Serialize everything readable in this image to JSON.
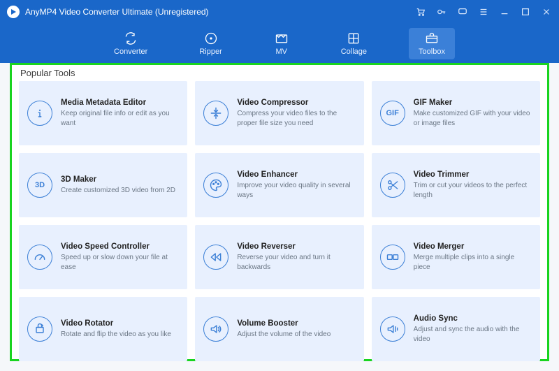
{
  "titlebar": {
    "app_title": "AnyMP4 Video Converter Ultimate (Unregistered)"
  },
  "nav": {
    "items": [
      {
        "label": "Converter"
      },
      {
        "label": "Ripper"
      },
      {
        "label": "MV"
      },
      {
        "label": "Collage"
      },
      {
        "label": "Toolbox"
      }
    ],
    "active_index": 4
  },
  "section": {
    "title": "Popular Tools"
  },
  "tools": [
    {
      "title": "Media Metadata Editor",
      "desc": "Keep original file info or edit as you want"
    },
    {
      "title": "Video Compressor",
      "desc": "Compress your video files to the proper file size you need"
    },
    {
      "title": "GIF Maker",
      "desc": "Make customized GIF with your video or image files"
    },
    {
      "title": "3D Maker",
      "desc": "Create customized 3D video from 2D"
    },
    {
      "title": "Video Enhancer",
      "desc": "Improve your video quality in several ways"
    },
    {
      "title": "Video Trimmer",
      "desc": "Trim or cut your videos to the perfect length"
    },
    {
      "title": "Video Speed Controller",
      "desc": "Speed up or slow down your file at ease"
    },
    {
      "title": "Video Reverser",
      "desc": "Reverse your video and turn it backwards"
    },
    {
      "title": "Video Merger",
      "desc": "Merge multiple clips into a single piece"
    },
    {
      "title": "Video Rotator",
      "desc": "Rotate and flip the video as you like"
    },
    {
      "title": "Volume Booster",
      "desc": "Adjust the volume of the video"
    },
    {
      "title": "Audio Sync",
      "desc": "Adjust and sync the audio with the video"
    }
  ],
  "icon_labels": {
    "gif": "GIF",
    "three_d": "3D"
  }
}
